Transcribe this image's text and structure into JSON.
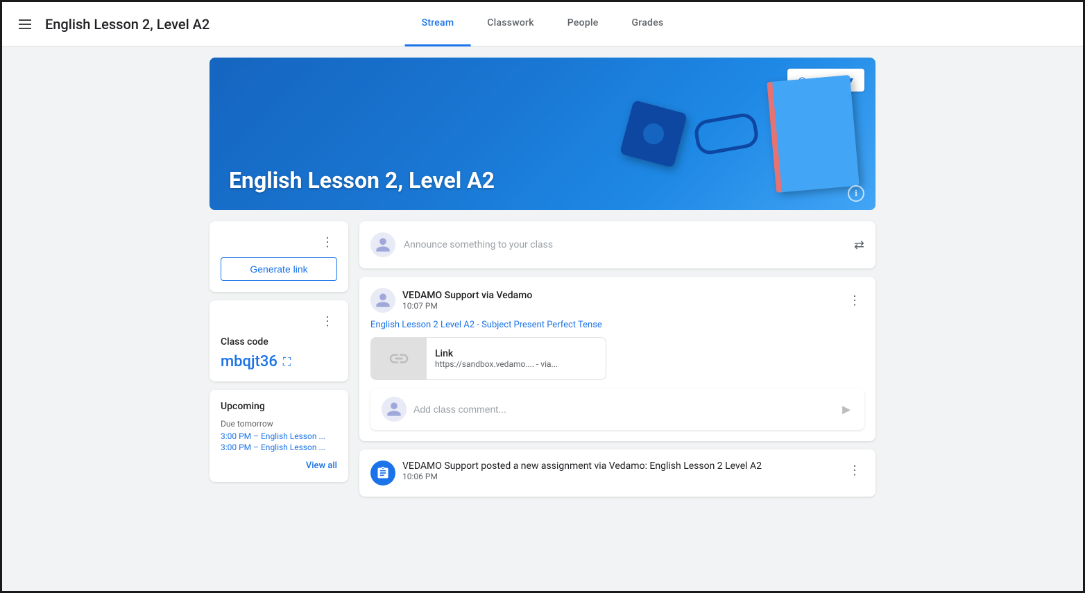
{
  "header": {
    "menu_icon": "☰",
    "title": "English Lesson 2, Level A2",
    "nav": [
      {
        "id": "stream",
        "label": "Stream",
        "active": true
      },
      {
        "id": "classwork",
        "label": "Classwork",
        "active": false
      },
      {
        "id": "people",
        "label": "People",
        "active": false
      },
      {
        "id": "grades",
        "label": "Grades",
        "active": false
      }
    ]
  },
  "banner": {
    "title": "English Lesson 2, Level A2",
    "customize_label": "Customize",
    "info_icon": "ℹ"
  },
  "sidebar": {
    "generate_link_card": {
      "button_label": "Generate link"
    },
    "class_code_card": {
      "label": "Class code",
      "code": "mbqjt36"
    },
    "upcoming_card": {
      "label": "Upcoming",
      "due_label": "Due tomorrow",
      "items": [
        "3:00 PM – English Lesson ...",
        "3:00 PM – English Lesson ..."
      ],
      "view_all_label": "View all"
    }
  },
  "stream": {
    "announce_placeholder": "Announce something to your class",
    "posts": [
      {
        "id": "post1",
        "author": "VEDAMO Support via Vedamo",
        "time": "10:07 PM",
        "body": "English Lesson 2 Level A2 - Subject Present Perfect Tense",
        "link": {
          "title": "Link",
          "url": "https://sandbox.vedamo.... - via..."
        }
      }
    ],
    "comment_placeholder": "Add class comment...",
    "assignment": {
      "text": "VEDAMO Support posted a new assignment via Vedamo: English Lesson 2 Level A2",
      "time": "10:06 PM"
    }
  }
}
